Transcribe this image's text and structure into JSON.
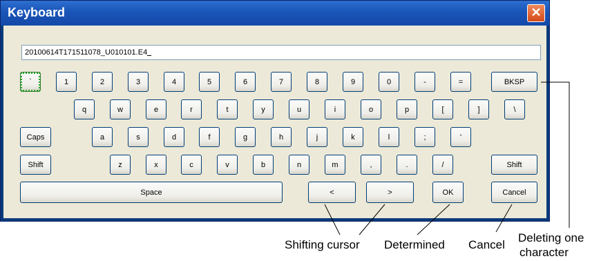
{
  "window": {
    "title": "Keyboard",
    "close_icon": "close-icon"
  },
  "input": {
    "value": "20100614T171511078_U010101.E4"
  },
  "rows": [
    [
      "`",
      "1",
      "2",
      "3",
      "4",
      "5",
      "6",
      "7",
      "8",
      "9",
      "0",
      "-",
      "=",
      "BKSP"
    ],
    [
      "q",
      "w",
      "e",
      "r",
      "t",
      "y",
      "u",
      "i",
      "o",
      "p",
      "[",
      "]",
      "\\"
    ],
    [
      "Caps",
      "a",
      "s",
      "d",
      "f",
      "g",
      "h",
      "j",
      "k",
      "l",
      ";",
      "'"
    ],
    [
      "Shift",
      "z",
      "x",
      "c",
      "v",
      "b",
      "n",
      "m",
      ",",
      ".",
      "/",
      "Shift"
    ],
    [
      "Space",
      "<",
      ">",
      "OK",
      "Cancel"
    ]
  ],
  "annotations": {
    "shifting_cursor": "Shifting cursor",
    "determined": "Determined",
    "cancel": "Cancel",
    "deleting_line1": "Deleting  one",
    "deleting_line2": "character"
  }
}
